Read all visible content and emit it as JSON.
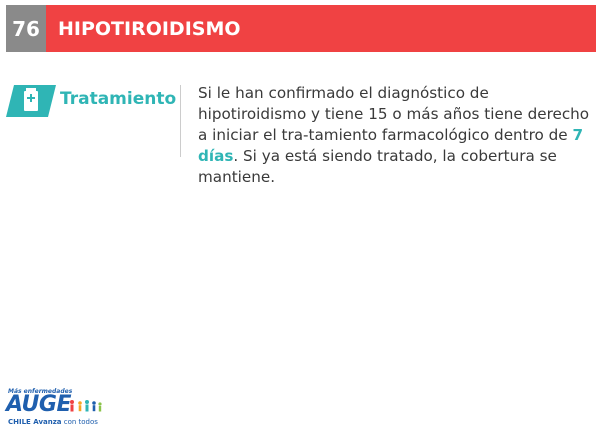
{
  "header": {
    "number": "76",
    "title": "HIPOTIROIDISMO"
  },
  "section": {
    "icon": "medicine-bottle-icon",
    "label": "Tratamiento",
    "text_part1": "Si le han confirmado el diagnóstico de hipotiroidismo y tiene 15 o más años tiene derecho a iniciar el tra-tamiento farmacológico dentro de ",
    "highlight": "7 días",
    "text_part2": ". Si ya está siendo tratado, la cobertura se mantiene."
  },
  "logo": {
    "tagline": "Más enfermedades",
    "name": "AUGE",
    "sub_bold": "CHILE Avanza",
    "sub_rest": " con todos"
  },
  "colors": {
    "title_red": "#f04243",
    "number_gray": "#8a8a8a",
    "accent_teal": "#2fb5b5",
    "logo_blue": "#1f5fae"
  }
}
